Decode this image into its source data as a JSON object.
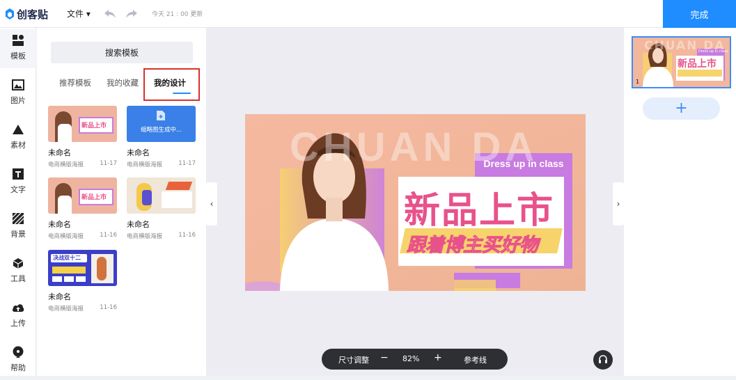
{
  "topbar": {
    "logo_text": "创客贴",
    "file_menu": "文件 ▾",
    "save_status": "今天 21 : 00 更新",
    "done_label": "完成"
  },
  "rail": {
    "items": [
      {
        "label": "模板",
        "icon": "template-icon"
      },
      {
        "label": "图片",
        "icon": "image-icon"
      },
      {
        "label": "素材",
        "icon": "shapes-icon"
      },
      {
        "label": "文字",
        "icon": "text-icon"
      },
      {
        "label": "背景",
        "icon": "background-icon"
      },
      {
        "label": "工具",
        "icon": "tools-icon"
      },
      {
        "label": "上传",
        "icon": "upload-icon"
      },
      {
        "label": "帮助",
        "icon": "help-icon"
      }
    ]
  },
  "panel": {
    "search_label": "搜索模板",
    "tabs": [
      "推荐模板",
      "我的收藏",
      "我的设计"
    ],
    "active_tab": "我的设计",
    "cards": [
      {
        "title": "未命名",
        "type": "电商横版海报",
        "date": "11-17",
        "thumb_text": "新品上市"
      },
      {
        "title": "未命名",
        "type": "电商横版海报",
        "date": "11-17",
        "thumb_text": "缩略图生成中..."
      },
      {
        "title": "未命名",
        "type": "电商横版海报",
        "date": "11-16",
        "thumb_text": "新品上市"
      },
      {
        "title": "未命名",
        "type": "电商横版海报",
        "date": "11-16",
        "thumb_text": ""
      },
      {
        "title": "未命名",
        "type": "电商横版海报",
        "date": "11-16",
        "thumb_text": "决战双十二"
      }
    ]
  },
  "canvas": {
    "bg_text": "CHUAN DA",
    "tag_text": "Dress up in class",
    "headline": "新品上市",
    "subline": "跟着博主买好物",
    "colors": {
      "bg": "#f2b79c",
      "accent": "#c87be0",
      "pink": "#e8528a",
      "yellow": "#f7d36c"
    }
  },
  "zoom": {
    "size_label": "尺寸调整",
    "minus": "−",
    "value": "82%",
    "plus": "+",
    "guides_label": "参考线"
  },
  "pages": {
    "current": "1",
    "thumb_headline": "新品上市",
    "thumb_bg_text": "CHUAN DA",
    "thumb_tag": "Dress up in class",
    "add_label": "+"
  }
}
